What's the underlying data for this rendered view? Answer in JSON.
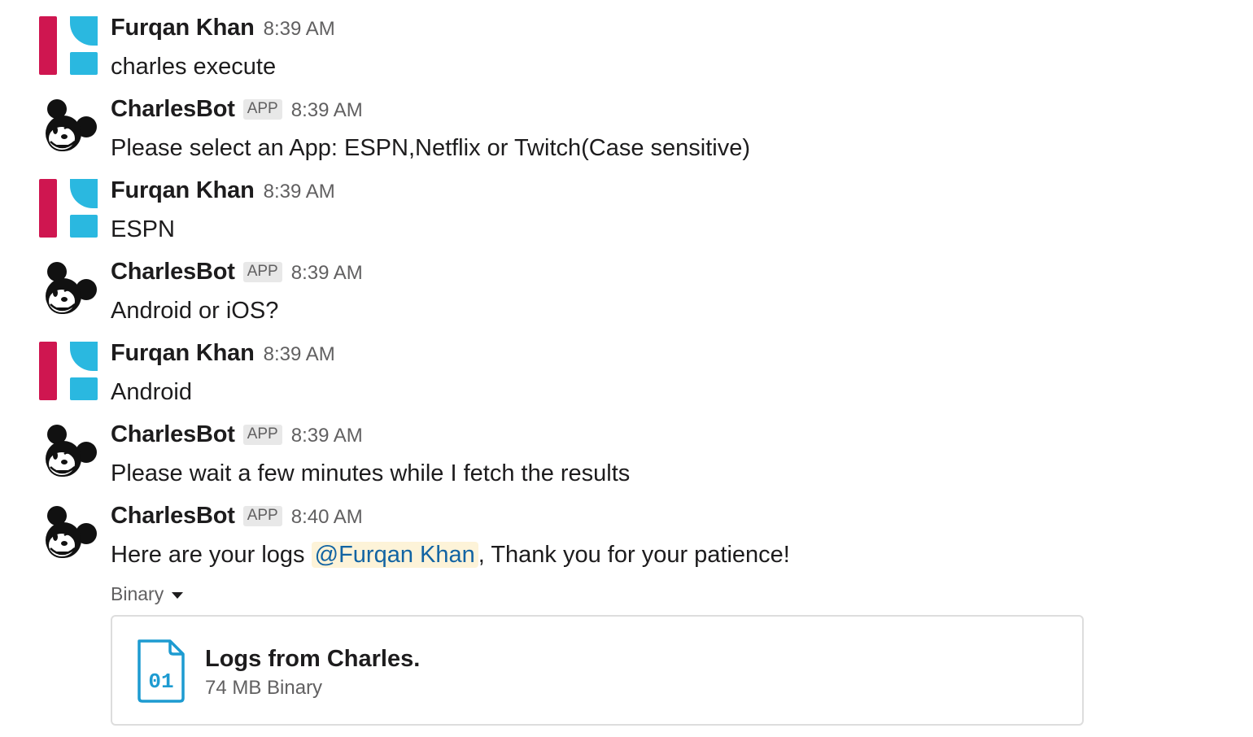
{
  "messages": [
    {
      "sender": "Furqan Khan",
      "is_app": false,
      "time": "8:39 AM",
      "text": "charles execute"
    },
    {
      "sender": "CharlesBot",
      "is_app": true,
      "badge": "APP",
      "time": "8:39 AM",
      "text": "Please select an App: ESPN,Netflix or Twitch(Case sensitive)"
    },
    {
      "sender": "Furqan Khan",
      "is_app": false,
      "time": "8:39 AM",
      "text": "ESPN"
    },
    {
      "sender": "CharlesBot",
      "is_app": true,
      "badge": "APP",
      "time": "8:39 AM",
      "text": "Android or iOS?"
    },
    {
      "sender": "Furqan Khan",
      "is_app": false,
      "time": "8:39 AM",
      "text": "Android"
    },
    {
      "sender": "CharlesBot",
      "is_app": true,
      "badge": "APP",
      "time": "8:39 AM",
      "text": "Please wait a few minutes while I fetch the results"
    },
    {
      "sender": "CharlesBot",
      "is_app": true,
      "badge": "APP",
      "time": "8:40 AM",
      "text_before": "Here are your logs ",
      "mention": "@Furqan Khan",
      "text_after": ", Thank you for your patience!"
    }
  ],
  "attachment": {
    "label": "Binary",
    "file_title": "Logs from Charles.",
    "file_meta": "74 MB Binary",
    "icon_text": "01",
    "icon": "binary-file-icon"
  },
  "colors": {
    "mention_text": "#1264a3",
    "mention_bg": "#fdf3d8",
    "file_icon": "#1d9bd1",
    "avatar_red": "#cf1650",
    "avatar_blue": "#2ab8e0"
  }
}
